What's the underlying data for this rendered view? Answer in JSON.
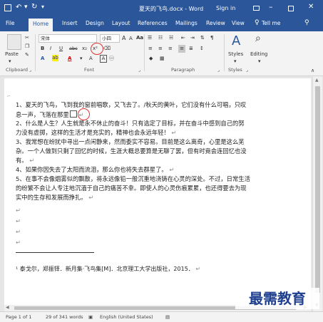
{
  "window": {
    "title": "夏天的飞鸟.docx - Word",
    "signin": "Sign in",
    "quick_access": [
      "save-icon",
      "undo-icon",
      "redo-icon",
      "customize-icon"
    ]
  },
  "tabs": [
    "File",
    "Home",
    "Insert",
    "Design",
    "Layout",
    "References",
    "Mailings",
    "Review",
    "View"
  ],
  "active_tab": "Home",
  "tellme": "Tell me",
  "ribbon": {
    "clipboard": {
      "paste": "Paste",
      "label": "Clipboard"
    },
    "font": {
      "name": "宋体",
      "size": "小四",
      "buttons": [
        "B",
        "I",
        "U",
        "abc",
        "x₂",
        "x²",
        "Aa",
        "A",
        "A",
        "A"
      ],
      "label": "Font"
    },
    "paragraph": {
      "label": "Paragraph"
    },
    "styles": {
      "styles": "Styles",
      "label": "Styles"
    },
    "editing": {
      "editing": "Editing"
    }
  },
  "document": {
    "lines": [
      "1、夏天的飞鸟，飞到我的窗前唱歌，又飞去了。/秋天的黄叶，它们没有什么可唱，只叹",
      "息一声，飞落在那里",
      "2、什么是人生？人生就是永不休止的奋斗！只有选定了目标，并在奋斗中感到自己的努",
      "力没有虚掷，这样的生活才是充实的，精神也会永远年轻！",
      "3、我常想在纷扰中寻出一点闲静来，然而委实不容易。目前是这么离奇，心里是这么芜",
      "杂。一个人做到只剩了回忆的时候，生涯大概总要算是无聊了罢，但有时竟会连回忆也没",
      "有。",
      "4、如果你因失去了太阳而流泪，那么你也将失去群星了。",
      "5、在事不会像烟雾似的飘散，将永远像铅一般沉重地浇铸在心灵的深处。不过，日常生活",
      "的纷繁不会让人专注地沉湎于自己的痛苦不幸。即使人的心灵伤痕累累，也还得要去为现",
      "实中的生存和发展而挣扎。"
    ],
    "footnote": "¹ 泰戈尔，郑振铎．新月集·飞鸟集[M]．北京理工大学出版社，2015．"
  },
  "status": {
    "page": "Page 1 of 1",
    "words": "29 of 341 words",
    "language": "English (United States)"
  },
  "watermark": "最需教育",
  "colors": {
    "accent": "#2b579a",
    "watermark": "#1f3f8f",
    "annotation": "#dd3333"
  }
}
